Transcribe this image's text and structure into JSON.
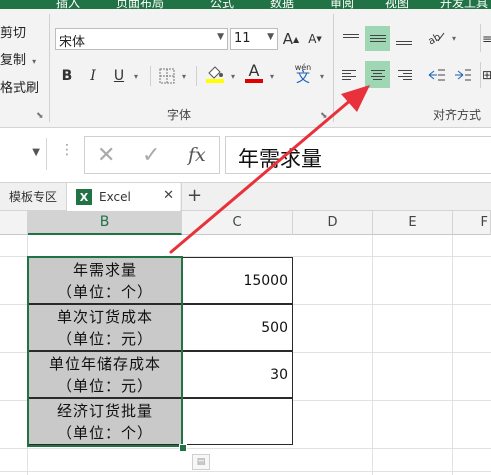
{
  "ribbon": {
    "tabs": [
      "插入",
      "页面布局",
      "公式",
      "数据",
      "审阅",
      "视图",
      "开发工具"
    ],
    "clipboard": {
      "cut": "剪切",
      "copy": "复制",
      "format_painter": "格式刷"
    },
    "font": {
      "name": "宋体",
      "size": "11",
      "bold": "B",
      "italic": "I",
      "underline": "U",
      "color_letter": "A",
      "highlight_color": "#ffff00",
      "font_color": "#e00000",
      "phonetic_top": "wén",
      "phonetic_char": "文",
      "group_label": "字体"
    },
    "alignment": {
      "group_label": "对齐方式",
      "selected_color": "#9fd6b4"
    }
  },
  "formula_bar": {
    "fx": "fx",
    "content": "年需求量"
  },
  "sheet_tabs": {
    "tabs": [
      {
        "label": "模板专区"
      },
      {
        "label": "Excel",
        "icon_letter": "X"
      }
    ],
    "add": "+"
  },
  "grid": {
    "columns": [
      "B",
      "C",
      "D",
      "E",
      "F"
    ],
    "rows": [
      {
        "b_line1": "年需求量",
        "b_line2": "（单位：个）",
        "c": "15000"
      },
      {
        "b_line1": "单次订货成本",
        "b_line2": "（单位：元）",
        "c": "500"
      },
      {
        "b_line1": "单位年储存成本",
        "b_line2": "（单位：元）",
        "c": "30"
      },
      {
        "b_line1": "经济订货批量",
        "b_line2": "（单位：个）",
        "c": ""
      }
    ]
  },
  "colors": {
    "excel_green": "#217346",
    "arrow_red": "#e8313a",
    "cell_gray": "#c9c9c9"
  }
}
